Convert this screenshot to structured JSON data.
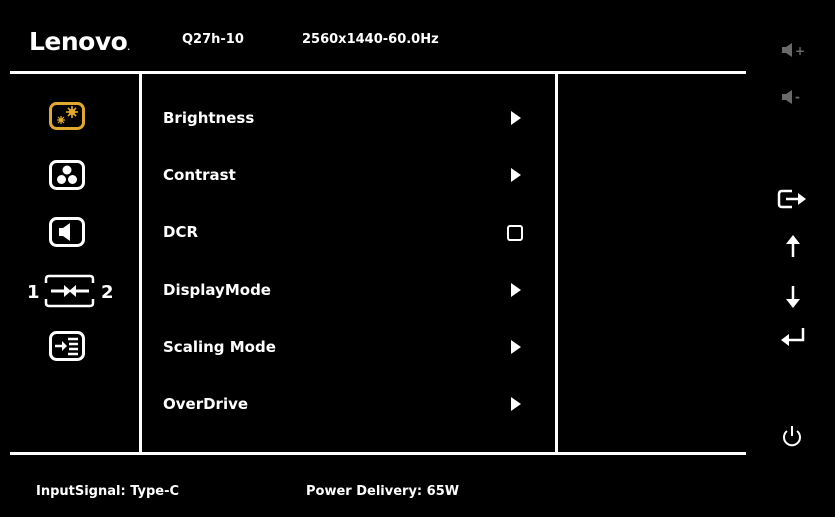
{
  "header": {
    "brand": "Lenovo",
    "model": "Q27h-10",
    "resolution": "2560x1440-60.0Hz"
  },
  "categories": [
    {
      "icon": "brightness-icon",
      "selected": true
    },
    {
      "icon": "color-icon",
      "selected": false
    },
    {
      "icon": "audio-icon",
      "selected": false
    },
    {
      "icon": "input-switch-icon",
      "labels": [
        "1",
        "2"
      ],
      "selected": false
    },
    {
      "icon": "menu-settings-icon",
      "selected": false
    }
  ],
  "menu": {
    "items": [
      {
        "label": "Brightness",
        "control": "submenu"
      },
      {
        "label": "Contrast",
        "control": "submenu"
      },
      {
        "label": "DCR",
        "control": "toggle-off"
      },
      {
        "label": "DisplayMode",
        "control": "submenu"
      },
      {
        "label": "Scaling Mode",
        "control": "submenu"
      },
      {
        "label": "OverDrive",
        "control": "submenu"
      }
    ]
  },
  "side_buttons": [
    {
      "icon": "volume-up-icon",
      "text": "+",
      "enabled": false
    },
    {
      "icon": "volume-down-icon",
      "text": "-",
      "enabled": false
    },
    {
      "icon": "exit-icon",
      "enabled": true
    },
    {
      "icon": "up-arrow-icon",
      "enabled": true
    },
    {
      "icon": "down-arrow-icon",
      "enabled": true
    },
    {
      "icon": "enter-icon",
      "enabled": true
    },
    {
      "icon": "power-icon",
      "enabled": true
    }
  ],
  "status": {
    "input_signal": "InputSignal: Type-C",
    "power_delivery": "Power Delivery: 65W"
  },
  "colors": {
    "background": "#000000",
    "text": "#ffffff",
    "accent": "#e0a830",
    "disabled": "#6a6a6a"
  }
}
